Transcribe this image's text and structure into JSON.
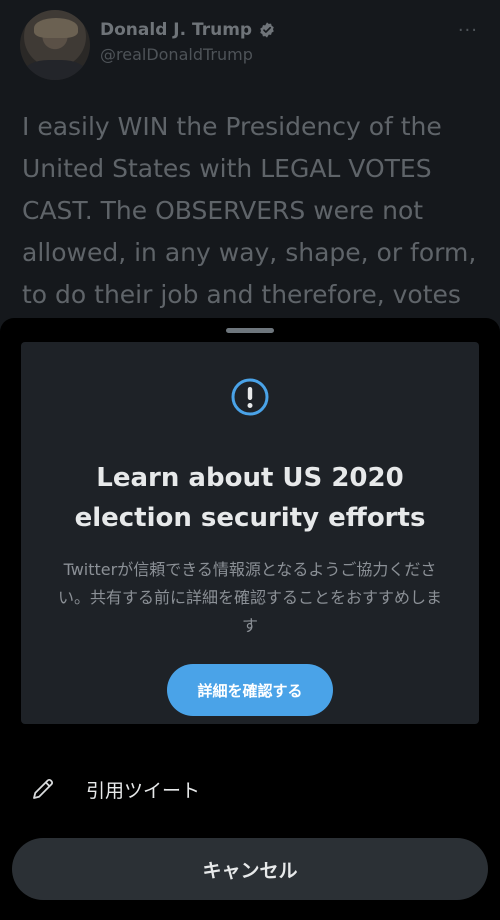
{
  "tweet": {
    "author_name": "Donald J. Trump",
    "author_handle": "@realDonaldTrump",
    "more_label": "···",
    "text": "I easily WIN the Presidency of the United States with LEGAL VOTES CAST. The OBSERVERS were not allowed, in any way, shape, or form, to do their job and therefore, votes"
  },
  "sheet": {
    "card": {
      "title": "Learn about US 2020 election security efforts",
      "body": "Twitterが信頼できる情報源となるようご協力ください。共有する前に詳細を確認することをおすすめします",
      "cta_label": "詳細を確認する"
    },
    "quote_tweet_label": "引用ツイート",
    "cancel_label": "キャンセル"
  },
  "colors": {
    "accent": "#4aa3e8",
    "background": "#15181c",
    "sheet_background": "#000000"
  }
}
